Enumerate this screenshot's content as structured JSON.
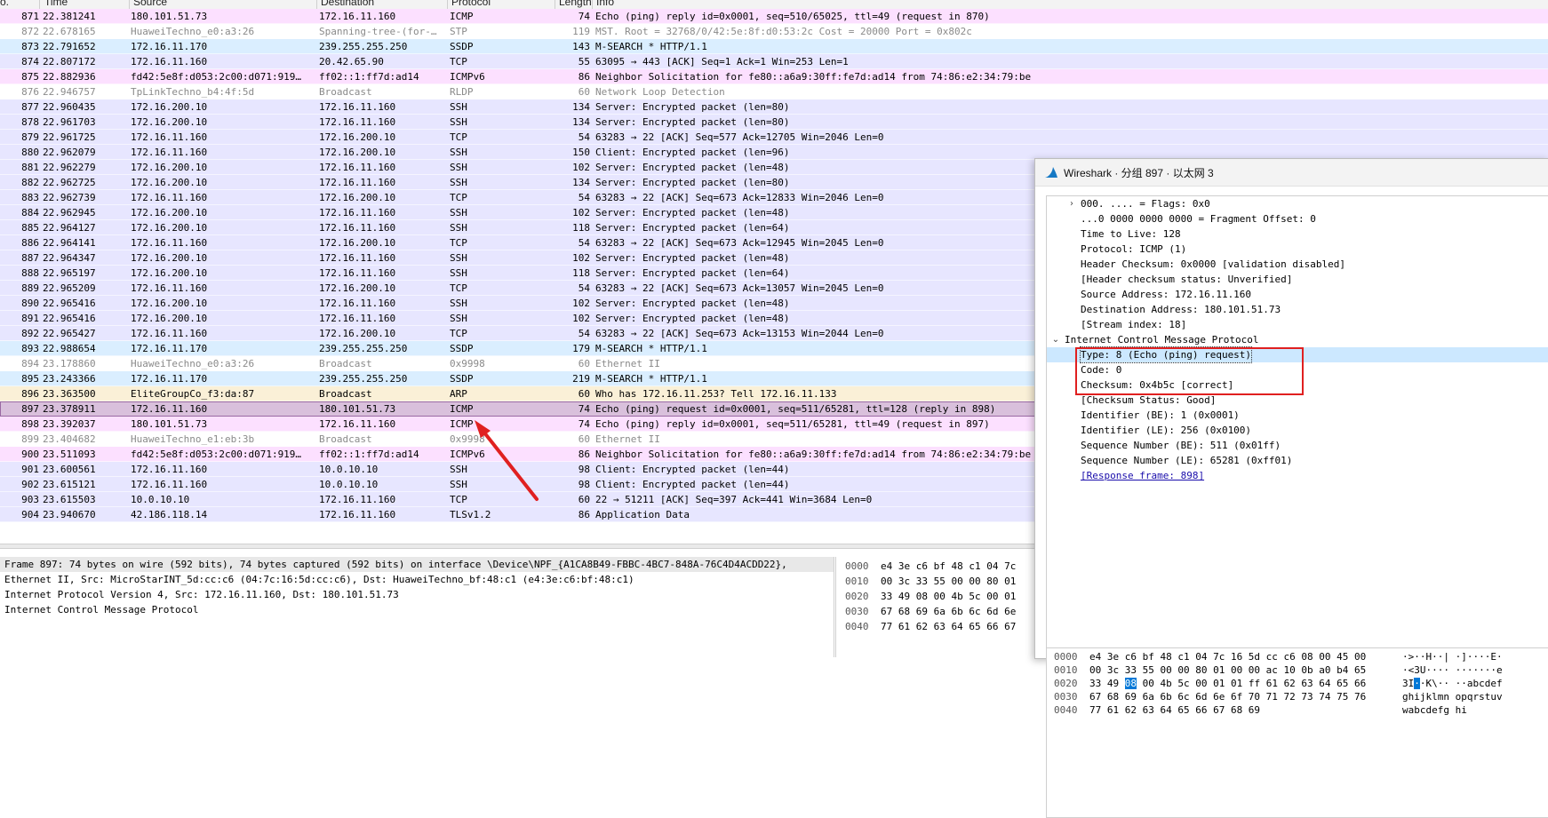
{
  "packet_list": {
    "columns": [
      "o.",
      "Time",
      "Source",
      "Destination",
      "Protocol",
      "Length",
      "Info"
    ],
    "rows": [
      {
        "no": "871",
        "time": "22.381241",
        "src": "180.101.51.73",
        "dst": "172.16.11.160",
        "proto": "ICMP",
        "len": "74",
        "info": "Echo (ping) reply    id=0x0001, seq=510/65025, ttl=49 (request in 870)",
        "color": "#fce0ff",
        "dim": false
      },
      {
        "no": "872",
        "time": "22.678165",
        "src": "HuaweiTechno_e0:a3:26",
        "dst": "Spanning-tree-(for-…",
        "proto": "STP",
        "len": "119",
        "info": "MST. Root = 32768/0/42:5e:8f:d0:53:2c  Cost = 20000  Port = 0x802c",
        "color": "#ffffff",
        "dim": true
      },
      {
        "no": "873",
        "time": "22.791652",
        "src": "172.16.11.170",
        "dst": "239.255.255.250",
        "proto": "SSDP",
        "len": "143",
        "info": "M-SEARCH * HTTP/1.1",
        "color": "#daeeff",
        "dim": false
      },
      {
        "no": "874",
        "time": "22.807172",
        "src": "172.16.11.160",
        "dst": "20.42.65.90",
        "proto": "TCP",
        "len": "55",
        "info": "63095 → 443 [ACK] Seq=1 Ack=1 Win=253 Len=1",
        "color": "#e7e6ff",
        "dim": false
      },
      {
        "no": "875",
        "time": "22.882936",
        "src": "fd42:5e8f:d053:2c00:d071:919…",
        "dst": "ff02::1:ff7d:ad14",
        "proto": "ICMPv6",
        "len": "86",
        "info": "Neighbor Solicitation for fe80::a6a9:30ff:fe7d:ad14 from 74:86:e2:34:79:be",
        "color": "#fce0ff",
        "dim": false
      },
      {
        "no": "876",
        "time": "22.946757",
        "src": "TpLinkTechno_b4:4f:5d",
        "dst": "Broadcast",
        "proto": "RLDP",
        "len": "60",
        "info": "Network Loop Detection",
        "color": "#ffffff",
        "dim": true
      },
      {
        "no": "877",
        "time": "22.960435",
        "src": "172.16.200.10",
        "dst": "172.16.11.160",
        "proto": "SSH",
        "len": "134",
        "info": "Server: Encrypted packet (len=80)",
        "color": "#e7e6ff",
        "dim": false
      },
      {
        "no": "878",
        "time": "22.961703",
        "src": "172.16.200.10",
        "dst": "172.16.11.160",
        "proto": "SSH",
        "len": "134",
        "info": "Server: Encrypted packet (len=80)",
        "color": "#e7e6ff",
        "dim": false
      },
      {
        "no": "879",
        "time": "22.961725",
        "src": "172.16.11.160",
        "dst": "172.16.200.10",
        "proto": "TCP",
        "len": "54",
        "info": "63283 → 22 [ACK] Seq=577 Ack=12705 Win=2046 Len=0",
        "color": "#e7e6ff",
        "dim": false
      },
      {
        "no": "880",
        "time": "22.962079",
        "src": "172.16.11.160",
        "dst": "172.16.200.10",
        "proto": "SSH",
        "len": "150",
        "info": "Client: Encrypted packet (len=96)",
        "color": "#e7e6ff",
        "dim": false
      },
      {
        "no": "881",
        "time": "22.962279",
        "src": "172.16.200.10",
        "dst": "172.16.11.160",
        "proto": "SSH",
        "len": "102",
        "info": "Server: Encrypted packet (len=48)",
        "color": "#e7e6ff",
        "dim": false
      },
      {
        "no": "882",
        "time": "22.962725",
        "src": "172.16.200.10",
        "dst": "172.16.11.160",
        "proto": "SSH",
        "len": "134",
        "info": "Server: Encrypted packet (len=80)",
        "color": "#e7e6ff",
        "dim": false
      },
      {
        "no": "883",
        "time": "22.962739",
        "src": "172.16.11.160",
        "dst": "172.16.200.10",
        "proto": "TCP",
        "len": "54",
        "info": "63283 → 22 [ACK] Seq=673 Ack=12833 Win=2046 Len=0",
        "color": "#e7e6ff",
        "dim": false
      },
      {
        "no": "884",
        "time": "22.962945",
        "src": "172.16.200.10",
        "dst": "172.16.11.160",
        "proto": "SSH",
        "len": "102",
        "info": "Server: Encrypted packet (len=48)",
        "color": "#e7e6ff",
        "dim": false
      },
      {
        "no": "885",
        "time": "22.964127",
        "src": "172.16.200.10",
        "dst": "172.16.11.160",
        "proto": "SSH",
        "len": "118",
        "info": "Server: Encrypted packet (len=64)",
        "color": "#e7e6ff",
        "dim": false
      },
      {
        "no": "886",
        "time": "22.964141",
        "src": "172.16.11.160",
        "dst": "172.16.200.10",
        "proto": "TCP",
        "len": "54",
        "info": "63283 → 22 [ACK] Seq=673 Ack=12945 Win=2045 Len=0",
        "color": "#e7e6ff",
        "dim": false
      },
      {
        "no": "887",
        "time": "22.964347",
        "src": "172.16.200.10",
        "dst": "172.16.11.160",
        "proto": "SSH",
        "len": "102",
        "info": "Server: Encrypted packet (len=48)",
        "color": "#e7e6ff",
        "dim": false
      },
      {
        "no": "888",
        "time": "22.965197",
        "src": "172.16.200.10",
        "dst": "172.16.11.160",
        "proto": "SSH",
        "len": "118",
        "info": "Server: Encrypted packet (len=64)",
        "color": "#e7e6ff",
        "dim": false
      },
      {
        "no": "889",
        "time": "22.965209",
        "src": "172.16.11.160",
        "dst": "172.16.200.10",
        "proto": "TCP",
        "len": "54",
        "info": "63283 → 22 [ACK] Seq=673 Ack=13057 Win=2045 Len=0",
        "color": "#e7e6ff",
        "dim": false
      },
      {
        "no": "890",
        "time": "22.965416",
        "src": "172.16.200.10",
        "dst": "172.16.11.160",
        "proto": "SSH",
        "len": "102",
        "info": "Server: Encrypted packet (len=48)",
        "color": "#e7e6ff",
        "dim": false
      },
      {
        "no": "891",
        "time": "22.965416",
        "src": "172.16.200.10",
        "dst": "172.16.11.160",
        "proto": "SSH",
        "len": "102",
        "info": "Server: Encrypted packet (len=48)",
        "color": "#e7e6ff",
        "dim": false
      },
      {
        "no": "892",
        "time": "22.965427",
        "src": "172.16.11.160",
        "dst": "172.16.200.10",
        "proto": "TCP",
        "len": "54",
        "info": "63283 → 22 [ACK] Seq=673 Ack=13153 Win=2044 Len=0",
        "color": "#e7e6ff",
        "dim": false
      },
      {
        "no": "893",
        "time": "22.988654",
        "src": "172.16.11.170",
        "dst": "239.255.255.250",
        "proto": "SSDP",
        "len": "179",
        "info": "M-SEARCH * HTTP/1.1",
        "color": "#daeeff",
        "dim": false
      },
      {
        "no": "894",
        "time": "23.178860",
        "src": "HuaweiTechno_e0:a3:26",
        "dst": "Broadcast",
        "proto": "0x9998",
        "len": "60",
        "info": "Ethernet II",
        "color": "#ffffff",
        "dim": true
      },
      {
        "no": "895",
        "time": "23.243366",
        "src": "172.16.11.170",
        "dst": "239.255.255.250",
        "proto": "SSDP",
        "len": "219",
        "info": "M-SEARCH * HTTP/1.1",
        "color": "#daeeff",
        "dim": false
      },
      {
        "no": "896",
        "time": "23.363500",
        "src": "EliteGroupCo_f3:da:87",
        "dst": "Broadcast",
        "proto": "ARP",
        "len": "60",
        "info": "Who has 172.16.11.253? Tell 172.16.11.133",
        "color": "#faf0d7",
        "dim": false
      },
      {
        "no": "897",
        "time": "23.378911",
        "src": "172.16.11.160",
        "dst": "180.101.51.73",
        "proto": "ICMP",
        "len": "74",
        "info": "Echo (ping) request  id=0x0001, seq=511/65281, ttl=128 (reply in 898)",
        "color": "#d9c0dc",
        "dim": false,
        "selected": true
      },
      {
        "no": "898",
        "time": "23.392037",
        "src": "180.101.51.73",
        "dst": "172.16.11.160",
        "proto": "ICMP",
        "len": "74",
        "info": "Echo (ping) reply    id=0x0001, seq=511/65281, ttl=49 (request in 897)",
        "color": "#fce0ff",
        "dim": false
      },
      {
        "no": "899",
        "time": "23.404682",
        "src": "HuaweiTechno_e1:eb:3b",
        "dst": "Broadcast",
        "proto": "0x9998",
        "len": "60",
        "info": "Ethernet II",
        "color": "#ffffff",
        "dim": true
      },
      {
        "no": "900",
        "time": "23.511093",
        "src": "fd42:5e8f:d053:2c00:d071:919…",
        "dst": "ff02::1:ff7d:ad14",
        "proto": "ICMPv6",
        "len": "86",
        "info": "Neighbor Solicitation for fe80::a6a9:30ff:fe7d:ad14 from 74:86:e2:34:79:be",
        "color": "#fce0ff",
        "dim": false
      },
      {
        "no": "901",
        "time": "23.600561",
        "src": "172.16.11.160",
        "dst": "10.0.10.10",
        "proto": "SSH",
        "len": "98",
        "info": "Client: Encrypted packet (len=44)",
        "color": "#e7e6ff",
        "dim": false
      },
      {
        "no": "902",
        "time": "23.615121",
        "src": "172.16.11.160",
        "dst": "10.0.10.10",
        "proto": "SSH",
        "len": "98",
        "info": "Client: Encrypted packet (len=44)",
        "color": "#e7e6ff",
        "dim": false
      },
      {
        "no": "903",
        "time": "23.615503",
        "src": "10.0.10.10",
        "dst": "172.16.11.160",
        "proto": "TCP",
        "len": "60",
        "info": "22 → 51211 [ACK] Seq=397 Ack=441 Win=3684 Len=0",
        "color": "#e7e6ff",
        "dim": false
      },
      {
        "no": "904",
        "time": "23.940670",
        "src": "42.186.118.14",
        "dst": "172.16.11.160",
        "proto": "TLSv1.2",
        "len": "86",
        "info": "Application Data",
        "color": "#e7e6ff",
        "dim": false
      }
    ]
  },
  "details": [
    "Frame 897: 74 bytes on wire (592 bits), 74 bytes captured (592 bits) on interface \\Device\\NPF_{A1CA8B49-FBBC-4BC7-848A-76C4D4ACDD22},",
    "Ethernet II, Src: MicroStarINT_5d:cc:c6 (04:7c:16:5d:cc:c6), Dst: HuaweiTechno_bf:48:c1 (e4:3e:c6:bf:48:c1)",
    "Internet Protocol Version 4, Src: 172.16.11.160, Dst: 180.101.51.73",
    "Internet Control Message Protocol"
  ],
  "bytes": [
    {
      "offset": "0000",
      "hex": "e4 3e c6 bf 48 c1 04 7c"
    },
    {
      "offset": "0010",
      "hex": "00 3c 33 55 00 00 80 01"
    },
    {
      "offset": "0020",
      "hex": "33 49 08 00 4b 5c 00 01"
    },
    {
      "offset": "0030",
      "hex": "67 68 69 6a 6b 6c 6d 6e"
    },
    {
      "offset": "0040",
      "hex": "77 61 62 63 64 65 66 67"
    }
  ],
  "popup": {
    "title": "Wireshark · 分组 897 · 以太网 3",
    "tree": [
      {
        "text": "000. .... = Flags: 0x0",
        "indent": 1,
        "arrow": "›"
      },
      {
        "text": "...0 0000 0000 0000 = Fragment Offset: 0",
        "indent": 1
      },
      {
        "text": "Time to Live: 128",
        "indent": 1
      },
      {
        "text": "Protocol: ICMP (1)",
        "indent": 1
      },
      {
        "text": "Header Checksum: 0x0000 [validation disabled]",
        "indent": 1
      },
      {
        "text": "[Header checksum status: Unverified]",
        "indent": 1
      },
      {
        "text": "Source Address: 172.16.11.160",
        "indent": 1
      },
      {
        "text": "Destination Address: 180.101.51.73",
        "indent": 1
      },
      {
        "text": "[Stream index: 18]",
        "indent": 1
      },
      {
        "text": "Internet Control Message Protocol",
        "indent": 0,
        "arrow": "⌄"
      },
      {
        "text": "Type: 8 (Echo (ping) request)",
        "indent": 1,
        "selected": true
      },
      {
        "text": "Code: 0",
        "indent": 1
      },
      {
        "text": "Checksum: 0x4b5c [correct]",
        "indent": 1
      },
      {
        "text": "[Checksum Status: Good]",
        "indent": 1
      },
      {
        "text": "Identifier (BE): 1 (0x0001)",
        "indent": 1
      },
      {
        "text": "Identifier (LE): 256 (0x0100)",
        "indent": 1
      },
      {
        "text": "Sequence Number (BE): 511 (0x01ff)",
        "indent": 1
      },
      {
        "text": "Sequence Number (LE): 65281 (0xff01)",
        "indent": 1
      },
      {
        "text": "[Response frame: 898]",
        "indent": 1,
        "link": true
      }
    ],
    "bytes": [
      {
        "offset": "0000",
        "hex": [
          "e4 3e c6 bf 48 c1 04 7c  16 5d cc c6 08 00 45 00"
        ],
        "ascii": "·>··H··| ·]····E·"
      },
      {
        "offset": "0010",
        "hex": [
          "00 3c 33 55 00 00 80 01  00 00 ac 10 0b a0 b4 65"
        ],
        "ascii": "·<3U···· ·······e"
      },
      {
        "offset": "0020",
        "hex_pre": "33 49 ",
        "hex_hl": "08",
        "hex_post": " 00 4b 5c 00 01  01 ff 61 62 63 64 65 66",
        "ascii_pre": "3I",
        "ascii_hl": "·",
        "ascii_post": "·K\\·· ··abcdef"
      },
      {
        "offset": "0030",
        "hex": [
          "67 68 69 6a 6b 6c 6d 6e  6f 70 71 72 73 74 75 76"
        ],
        "ascii": "ghijklmn opqrstuv"
      },
      {
        "offset": "0040",
        "hex": [
          "77 61 62 63 64 65 66 67  68 69"
        ],
        "ascii": "wabcdefg hi"
      }
    ]
  },
  "annotation": {
    "color": "#e02020"
  }
}
